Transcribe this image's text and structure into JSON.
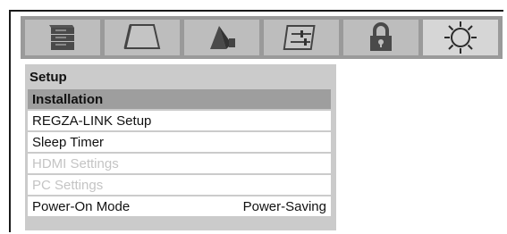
{
  "tabs": [
    {
      "icon": "picture-settings-icon",
      "active": false
    },
    {
      "icon": "screen-icon",
      "active": false
    },
    {
      "icon": "audio-speaker-icon",
      "active": false
    },
    {
      "icon": "preferences-sliders-icon",
      "active": false
    },
    {
      "icon": "lock-icon",
      "active": false
    },
    {
      "icon": "gear-icon",
      "active": true
    }
  ],
  "panel": {
    "title": "Setup",
    "items": [
      {
        "label": "Installation",
        "value": "",
        "state": "selected"
      },
      {
        "label": "REGZA-LINK Setup",
        "value": "",
        "state": "normal"
      },
      {
        "label": "Sleep Timer",
        "value": "",
        "state": "normal"
      },
      {
        "label": "HDMI Settings",
        "value": "",
        "state": "disabled"
      },
      {
        "label": "PC Settings",
        "value": "",
        "state": "disabled"
      },
      {
        "label": "Power-On Mode",
        "value": "Power-Saving",
        "state": "normal"
      }
    ]
  },
  "colors": {
    "icon_bar": "#9a9a9a",
    "tab": "#bdbdbd",
    "tab_active": "#d6d6d6",
    "panel": "#cbcbcb",
    "selected_row": "#9e9e9e",
    "disabled_text": "#c4c4c4"
  }
}
